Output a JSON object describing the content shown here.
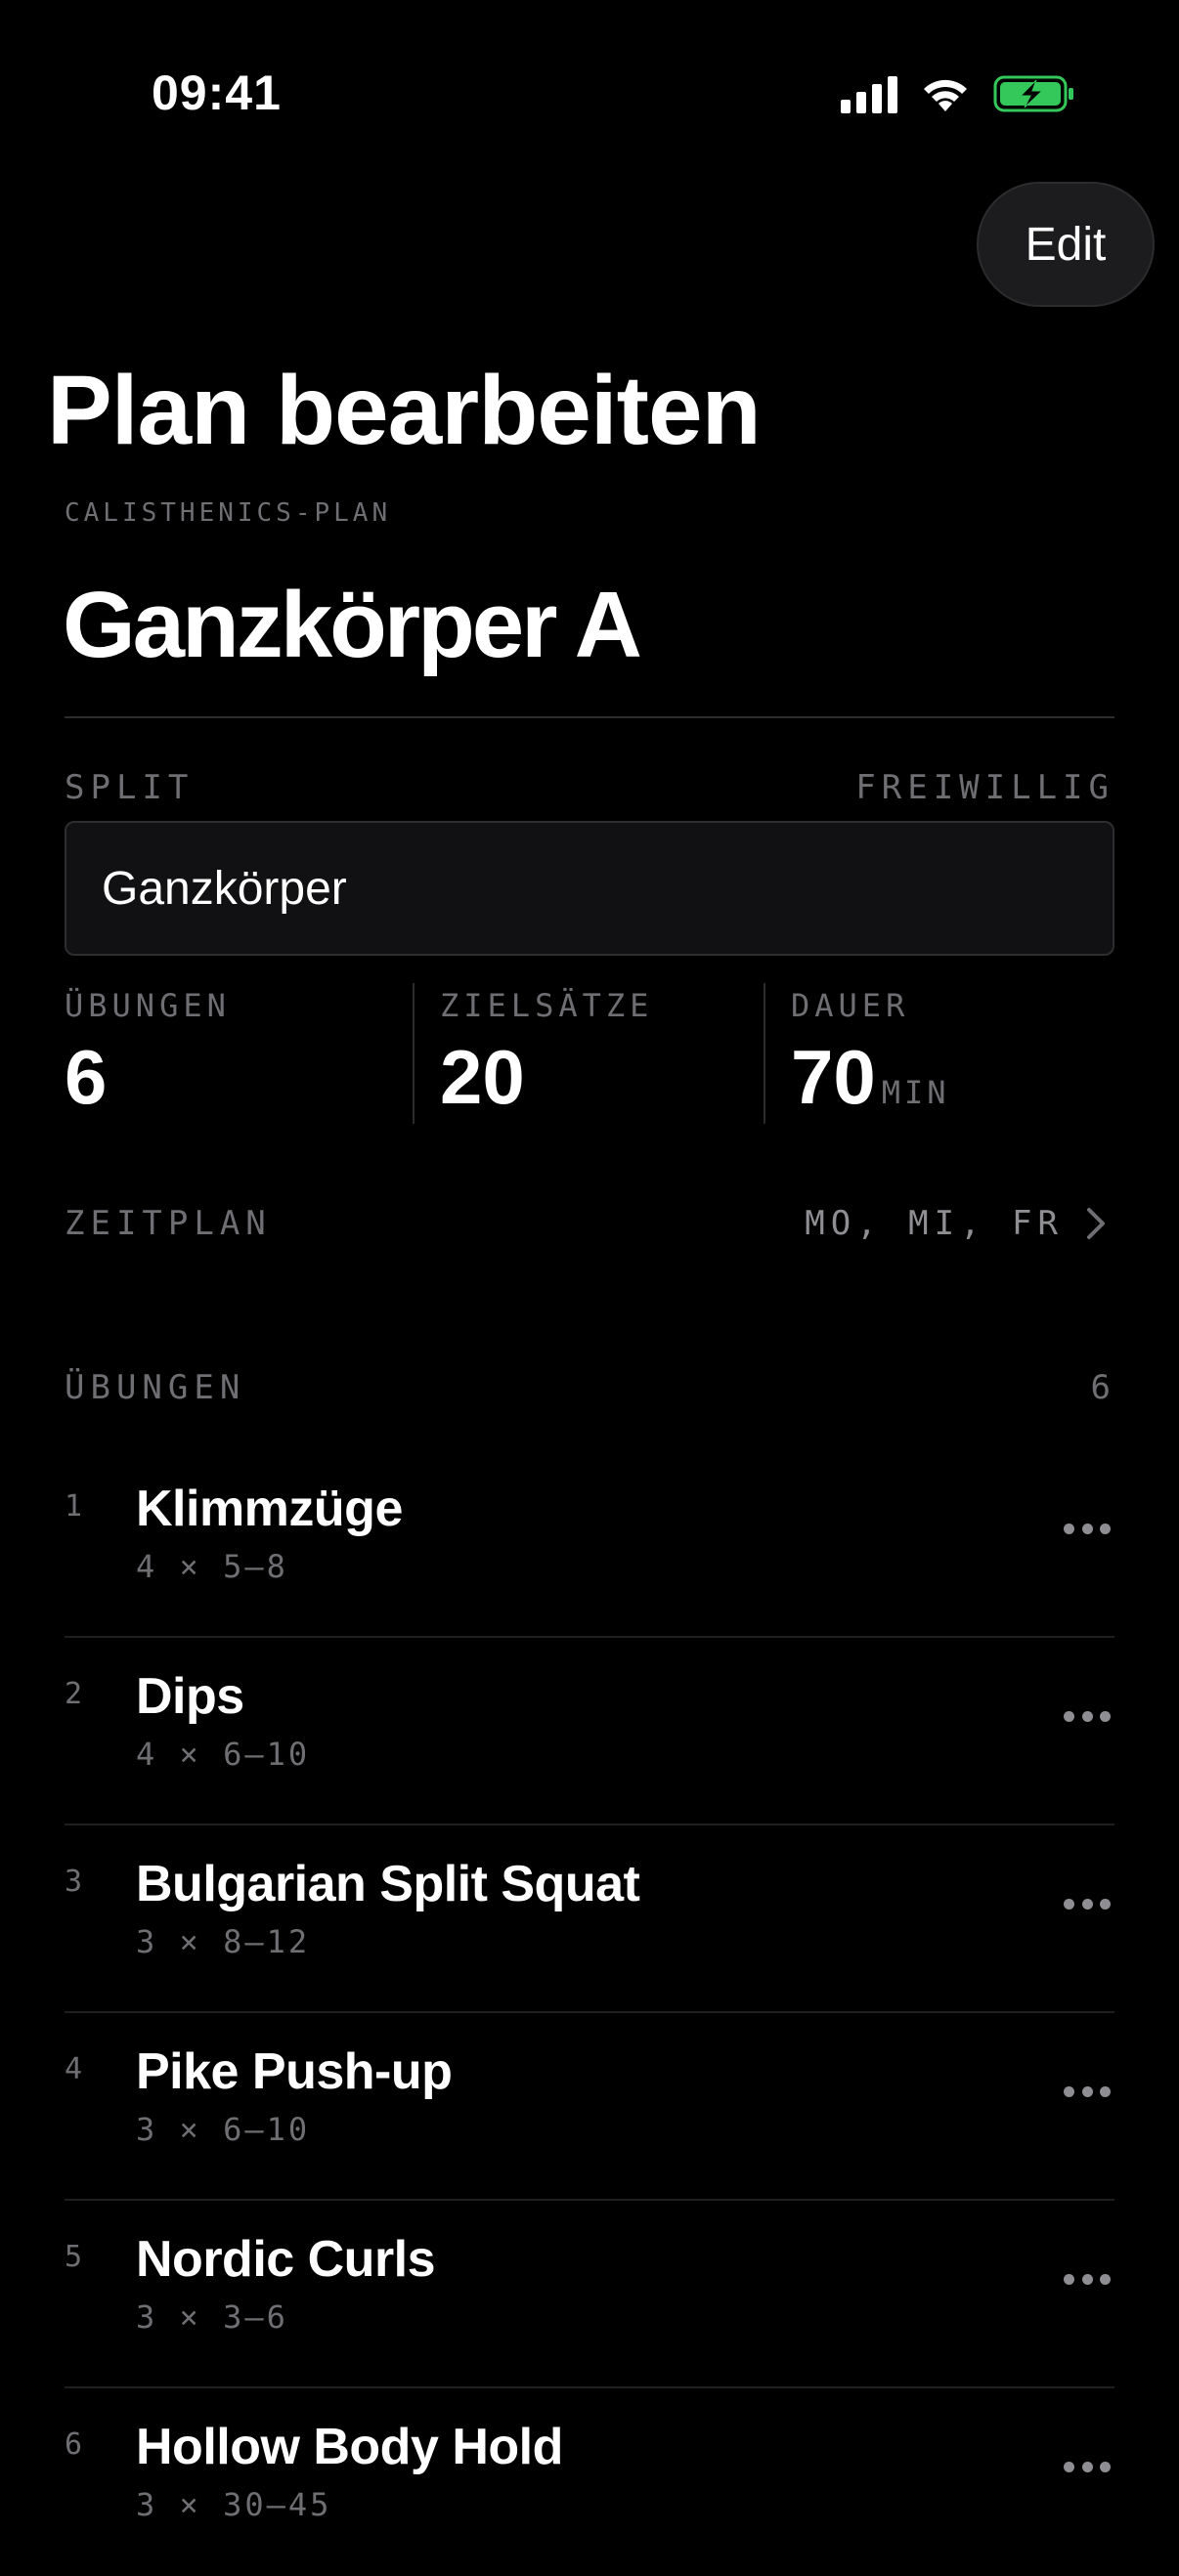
{
  "status_bar": {
    "time": "09:41"
  },
  "header": {
    "edit_label": "Edit",
    "page_title": "Plan bearbeiten"
  },
  "plan": {
    "kicker": "CALISTHENICS-PLAN",
    "name": "Ganzkörper A"
  },
  "split": {
    "label": "SPLIT",
    "optional_label": "FREIWILLIG",
    "value": "Ganzkörper"
  },
  "stats": {
    "exercises_label": "ÜBUNGEN",
    "exercises_value": "6",
    "target_sets_label": "ZIELSÄTZE",
    "target_sets_value": "20",
    "duration_label": "DAUER",
    "duration_value": "70",
    "duration_unit": "MIN"
  },
  "schedule": {
    "label": "ZEITPLAN",
    "value": "MO, MI, FR"
  },
  "exercises_section": {
    "title": "ÜBUNGEN",
    "count": "6",
    "items": [
      {
        "index": "1",
        "name": "Klimmzüge",
        "sets": "4 × 5–8"
      },
      {
        "index": "2",
        "name": "Dips",
        "sets": "4 × 6–10"
      },
      {
        "index": "3",
        "name": "Bulgarian Split Squat",
        "sets": "3 × 8–12"
      },
      {
        "index": "4",
        "name": "Pike Push-up",
        "sets": "3 × 6–10"
      },
      {
        "index": "5",
        "name": "Nordic Curls",
        "sets": "3 × 3–6"
      },
      {
        "index": "6",
        "name": "Hollow Body Hold",
        "sets": "3 × 30–45"
      }
    ]
  },
  "icons": {
    "signal": "cellular-signal-icon",
    "wifi": "wifi-icon",
    "battery": "battery-charging-icon",
    "chevron": "chevron-right-icon",
    "more": "more-horizontal-icon"
  },
  "colors": {
    "background": "#000000",
    "surface": "#111113",
    "muted_text": "#6e6e73",
    "battery_green": "#34c759"
  }
}
